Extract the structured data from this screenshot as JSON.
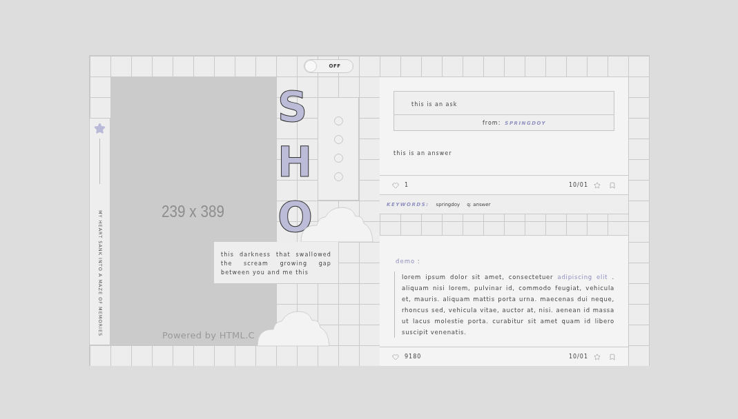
{
  "toggle": {
    "label": "OFF",
    "on": false
  },
  "sidebar": {
    "text": "MY HEART SANK INTO A MAZE OF MEMORIES"
  },
  "image_placeholder": {
    "size_label": "239 x 389",
    "credit": "Powered by HTML.C"
  },
  "big_letters": [
    "S",
    "H",
    "O"
  ],
  "caption": "this darkness that swallowed the scream growing gap between you and me this",
  "posts": [
    {
      "kind": "ask",
      "ask": "this is an ask",
      "from_label": "from:",
      "from_user": "SPRINGDOY",
      "answer": "this is an answer",
      "likes": "1",
      "date": "10/01",
      "keywords_label": "KEYWORDS:",
      "tags": [
        "springdoy",
        "q: answer"
      ]
    },
    {
      "kind": "text",
      "title": "**demo** :",
      "body": "lorem ipsum dolor sit amet, consectetuer **adipiscing elit** . aliquam nisi lorem, pulvinar id, commodo feugiat, vehicula et, mauris. aliquam mattis porta urna. maecenas dui neque, rhoncus sed, vehicula vitae, auctor at, nisi. aenean id massa ut lacus molestie porta. curabitur sit amet quam id libero suscipit venenatis.",
      "likes": "9180",
      "date": "10/01"
    }
  ]
}
